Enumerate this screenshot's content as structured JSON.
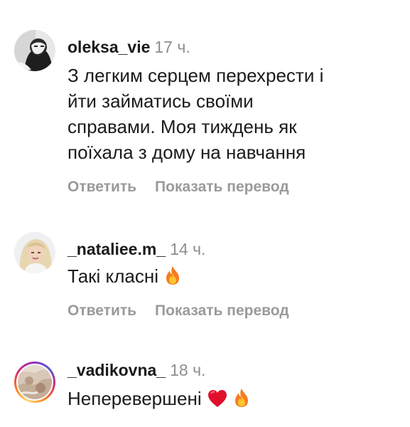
{
  "comments": [
    {
      "username": "oleksa_vie",
      "time": "17 ч.",
      "text_lines": [
        "З легким серцем перехрести і",
        "йти займатись своїми",
        "справами. Моя тиждень як",
        "поїхала з дому на навчання"
      ],
      "reply_label": "Ответить",
      "translate_label": "Показать перевод",
      "avatar_icon": "profile-photo",
      "has_story_ring": false
    },
    {
      "username": "_nataliee.m_",
      "time": "14 ч.",
      "text_lines": [
        "Такі класні"
      ],
      "emojis": [
        "fire-emoji"
      ],
      "reply_label": "Ответить",
      "translate_label": "Показать перевод",
      "avatar_icon": "profile-photo",
      "has_story_ring": false
    },
    {
      "username": "_vadikovna_",
      "time": "18 ч.",
      "text_lines": [
        "Неперевершені"
      ],
      "emojis": [
        "red-heart-emoji",
        "fire-emoji"
      ],
      "avatar_icon": "profile-photo",
      "has_story_ring": true
    }
  ],
  "colors": {
    "text": "#1b1b1b",
    "muted": "#8e8e8e",
    "action": "#9a9a9a",
    "heart": "#e0102d",
    "fire": "#f5a623"
  }
}
